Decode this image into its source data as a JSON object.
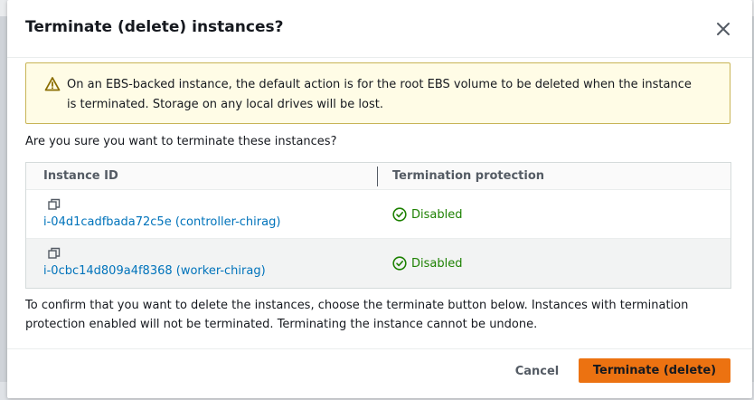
{
  "dialog": {
    "title": "Terminate (delete) instances?",
    "close_icon": "close-icon"
  },
  "warning": {
    "icon": "warning-triangle-icon",
    "text": "On an EBS-backed instance, the default action is for the root EBS volume to be deleted when the instance is terminated. Storage on any local drives will be lost."
  },
  "question": "Are you sure you want to terminate these instances?",
  "table": {
    "columns": [
      "Instance ID",
      "Termination protection"
    ],
    "rows": [
      {
        "instance": "i-04d1cadfbada72c5e (controller-chirag)",
        "protection": "Disabled"
      },
      {
        "instance": "i-0cbc14d809a4f8368 (worker-chirag)",
        "protection": "Disabled"
      }
    ]
  },
  "confirm_text": "To confirm that you want to delete the instances, choose the terminate button below. Instances with termination protection enabled will not be terminated. Terminating the instance cannot be undone.",
  "footer": {
    "cancel_label": "Cancel",
    "terminate_label": "Terminate (delete)"
  },
  "colors": {
    "accent": "#ec7211",
    "link": "#0073bb",
    "success": "#1d8102",
    "warning_bg": "#fffce6"
  }
}
